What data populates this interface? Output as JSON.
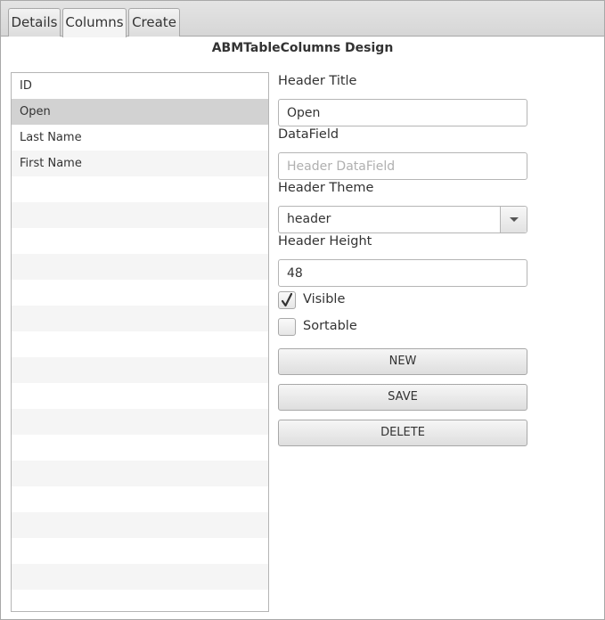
{
  "tabs": [
    {
      "label": "Details"
    },
    {
      "label": "Columns"
    },
    {
      "label": "Create"
    }
  ],
  "page_title": "ABMTableColumns Design",
  "column_list": {
    "items": [
      "ID",
      "Open",
      "Last Name",
      "First Name"
    ],
    "selected": "Open"
  },
  "form": {
    "header_title_label": "Header Title",
    "header_title_value": "Open",
    "datafield_label": "DataField",
    "datafield_placeholder": "Header DataField",
    "header_theme_label": "Header Theme",
    "header_theme_value": "header",
    "header_height_label": "Header Height",
    "header_height_value": "48",
    "visible_label": "Visible",
    "visible_checked": true,
    "sortable_label": "Sortable",
    "sortable_checked": false
  },
  "buttons": {
    "new_label": "NEW",
    "save_label": "SAVE",
    "delete_label": "DELETE"
  }
}
